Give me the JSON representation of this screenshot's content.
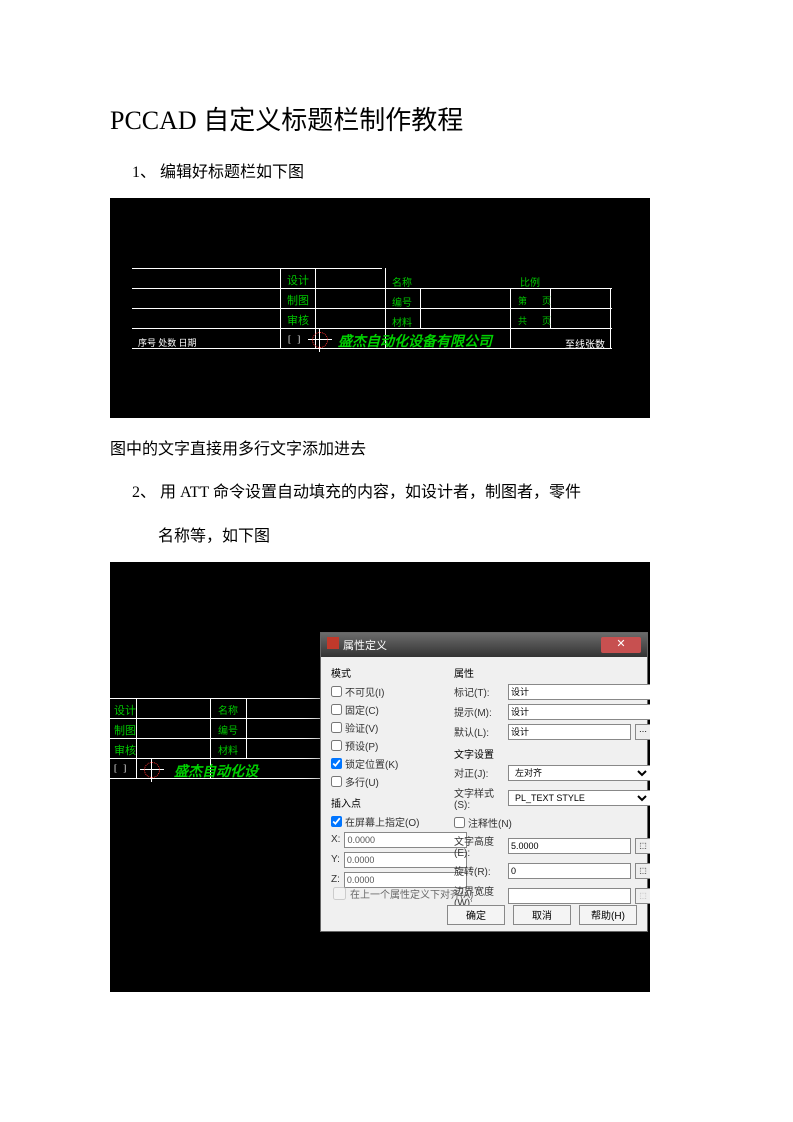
{
  "title": "PCCAD 自定义标题栏制作教程",
  "step1": "1、 编辑好标题栏如下图",
  "caption1": "图中的文字直接用多行文字添加进去",
  "step2a": "2、 用 ATT 命令设置自动填充的内容，如设计者，制图者，零件",
  "step2b": "名称等，如下图",
  "cad": {
    "sheji": "设计",
    "zhitu": "制图",
    "shenhe": "审核",
    "mingcheng": "名称",
    "bianhao": "编号",
    "cailiao": "材料",
    "bili": "比例",
    "di": "第",
    "ye": "页",
    "gong": "共",
    "ye2": "页",
    "xuhao": "序号 处数 日期",
    "company": "盛杰自动化设备有限公司",
    "company2": "盛杰自动化设",
    "right": "至线张数"
  },
  "dialog": {
    "title": "属性定义",
    "section_mode": "模式",
    "chk_invisible": "不可见(I)",
    "chk_fixed": "固定(C)",
    "chk_verify": "验证(V)",
    "chk_preset": "预设(P)",
    "chk_lock": "锁定位置(K)",
    "chk_mtext": "多行(U)",
    "section_insert": "插入点",
    "chk_onscreen": "在屏幕上指定(O)",
    "x_label": "X:",
    "y_label": "Y:",
    "z_label": "Z:",
    "x_val": "0.0000",
    "y_val": "0.0000",
    "z_val": "0.0000",
    "section_attr": "属性",
    "tag_label": "标记(T):",
    "tag_val": "设计",
    "prompt_label": "提示(M):",
    "prompt_val": "设计",
    "default_label": "默认(L):",
    "default_val": "设计",
    "section_txt": "文字设置",
    "just_label": "对正(J):",
    "just_val": "左对齐",
    "style_label": "文字样式(S):",
    "style_val": "PL_TEXT STYLE",
    "chk_anno": "注释性(N)",
    "height_label": "文字高度(E):",
    "height_val": "5.0000",
    "rot_label": "旋转(R):",
    "rot_val": "0",
    "bwidth_label": "边界宽度(W):",
    "bwidth_val": "",
    "foot_chk": "在上一个属性定义下对齐(A)",
    "ok": "确定",
    "cancel": "取消",
    "help": "帮助(H)"
  }
}
